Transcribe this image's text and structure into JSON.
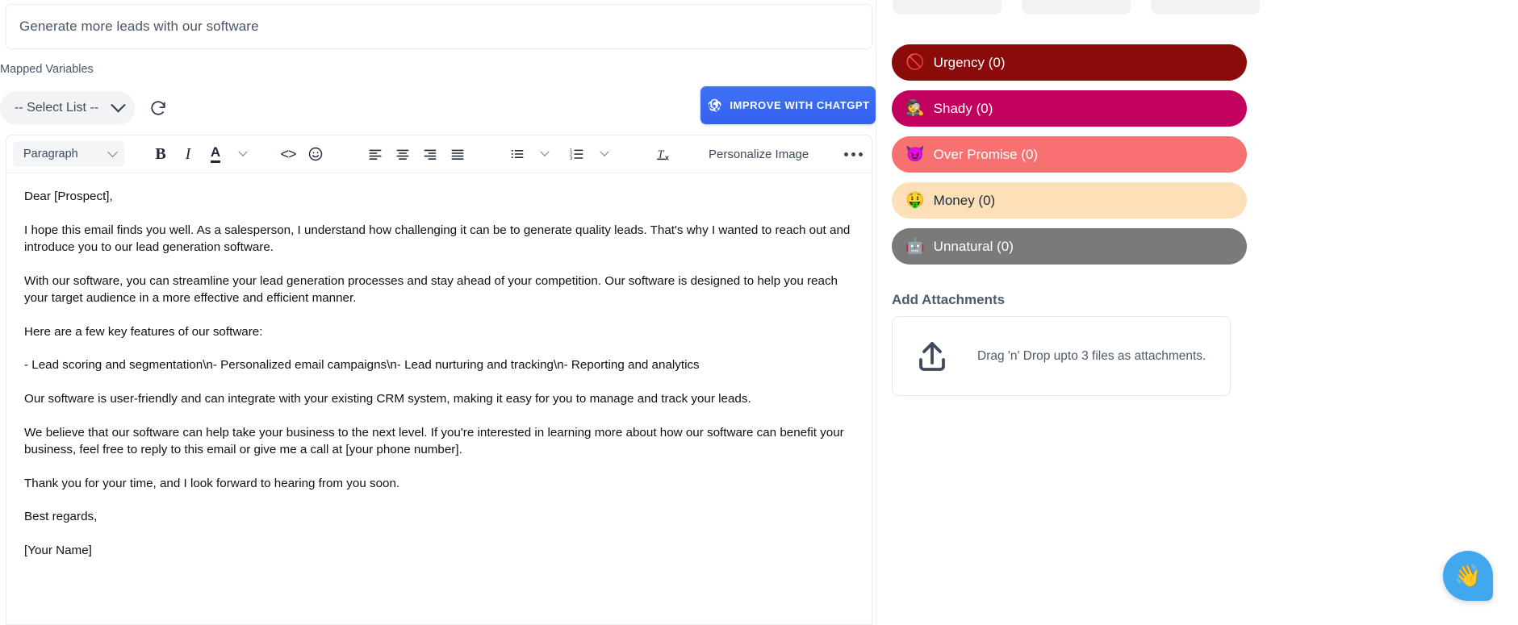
{
  "subject": {
    "value": "Generate more leads with our software"
  },
  "mapped_variables": {
    "label": "Mapped Variables",
    "select_value": "-- Select List --",
    "refresh_icon": "refresh-icon"
  },
  "improve_button": {
    "label": "IMPROVE WITH CHATGPT",
    "icon": "openai-logo-icon",
    "color": "#3b6ef5"
  },
  "toolbar": {
    "block_format": "Paragraph",
    "buttons": [
      {
        "name": "bold-button",
        "glyph": "B"
      },
      {
        "name": "italic-button",
        "glyph": "I"
      },
      {
        "name": "font-color-button",
        "glyph": "A"
      },
      {
        "name": "font-color-dropdown",
        "glyph": "chevron-down"
      },
      {
        "name": "source-code-button",
        "glyph": "<>"
      },
      {
        "name": "emoji-button",
        "glyph": "smiley"
      },
      {
        "name": "align-left-button",
        "glyph": "align-left"
      },
      {
        "name": "align-center-button",
        "glyph": "align-center"
      },
      {
        "name": "align-right-button",
        "glyph": "align-right"
      },
      {
        "name": "align-justify-button",
        "glyph": "align-justify"
      },
      {
        "name": "bullet-list-button",
        "glyph": "bullet-list"
      },
      {
        "name": "bullet-list-dropdown",
        "glyph": "chevron-down"
      },
      {
        "name": "numbered-list-button",
        "glyph": "numbered-list"
      },
      {
        "name": "numbered-list-dropdown",
        "glyph": "chevron-down"
      },
      {
        "name": "clear-formatting-button",
        "glyph": "Tx"
      }
    ],
    "personalize_image": "Personalize Image",
    "more_options": "more-options-icon"
  },
  "email_body": {
    "paragraphs": [
      "Dear [Prospect],",
      "I hope this email finds you well. As a salesperson, I understand how challenging it can be to generate quality leads. That's why I wanted to reach out and introduce you to our lead generation software.",
      "With our software, you can streamline your lead generation processes and stay ahead of your competition. Our software is designed to help you reach your target audience in a more effective and efficient manner.",
      "Here are a few key features of our software:",
      "- Lead scoring and segmentation\\n- Personalized email campaigns\\n- Lead nurturing and tracking\\n- Reporting and analytics",
      "Our software is user-friendly and can integrate with your existing CRM system, making it easy for you to manage and track your leads.",
      "We believe that our software can help take your business to the next level. If you're interested in learning more about how our software can benefit your business, feel free to reply to this email or give me a call at [your phone number].",
      "Thank you for your time, and I look forward to hearing from you soon.",
      "Best regards,",
      "[Your Name]"
    ]
  },
  "tags": [
    {
      "label": "Urgency (0)",
      "emoji": "🚫",
      "bg": "#8b0a0a",
      "fg": "#ffffff",
      "name": "tag-urgency"
    },
    {
      "label": "Shady (0)",
      "emoji": "🕵️",
      "bg": "#c2005e",
      "fg": "#ffffff",
      "name": "tag-shady"
    },
    {
      "label": "Over Promise (0)",
      "emoji": "😈",
      "bg": "#f87171",
      "fg": "#ffffff",
      "name": "tag-over-promise"
    },
    {
      "label": "Money (0)",
      "emoji": "🤑",
      "bg": "#fde0b7",
      "fg": "#1f2937",
      "name": "tag-money"
    },
    {
      "label": "Unnatural (0)",
      "emoji": "🤖",
      "bg": "#7a7a7a",
      "fg": "#ffffff",
      "name": "tag-unnatural"
    }
  ],
  "attachments": {
    "title": "Add Attachments",
    "dropzone_text": "Drag 'n' Drop upto 3 files as attachments.",
    "upload_icon": "upload-icon"
  },
  "chat_fab": {
    "emoji": "👋",
    "color": "#41a8f0",
    "name": "chat-widget-button"
  }
}
